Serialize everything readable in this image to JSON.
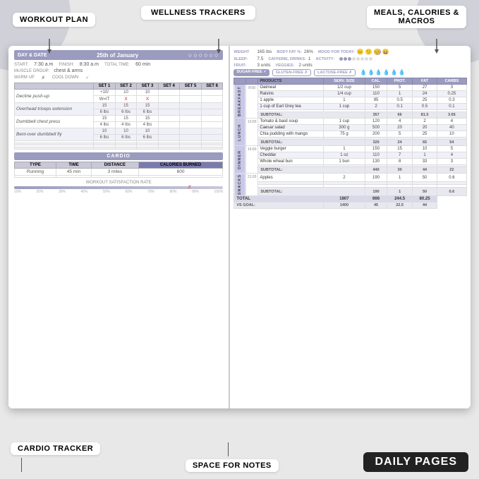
{
  "labels": {
    "workout_plan": "WORKOUT PLAN",
    "wellness_trackers": "WELLNESS TRACKERS",
    "meals_calories": "MEALS, CALORIES &",
    "meals_macros": "MACROS",
    "cardio_tracker": "CARDIO TRACKER",
    "space_for_notes": "SPACE FOR NOTES",
    "daily_pages": "DAILY PAGES"
  },
  "left_page": {
    "day_date_label": "DAY & DATE",
    "date_value": "25th of January",
    "start_label": "START:",
    "start_value": "7:30 a.m",
    "finish_label": "FINISH:",
    "finish_value": "8:30 a.m",
    "total_label": "TOTAL TIME:",
    "total_value": "60 min",
    "muscle_label": "MUSCLE GROUP:",
    "muscle_value": "chest & arms",
    "warm_up_label": "WARM UP",
    "cool_down_label": "COOL DOWN",
    "set_headers": [
      "SET 1",
      "SET 2",
      "SET 3",
      "SET 4",
      "SET 5",
      "SET 6"
    ],
    "exercises": [
      {
        "name": "Decline push-up",
        "sets": [
          "+10/",
          "10",
          "10",
          "",
          "",
          ""
        ]
      },
      {
        "name": "Overhead triceps extension",
        "sets": [
          "W=IT",
          "X",
          "X",
          "",
          "",
          ""
        ]
      },
      {
        "name": "Overhead triceps extension",
        "sets": [
          "15",
          "15",
          "15",
          "",
          "",
          ""
        ]
      },
      {
        "name": "Dumbbell chest press",
        "sets": [
          "6 lbs",
          "6 lbs",
          "6 lbs",
          "",
          "",
          ""
        ]
      },
      {
        "name": "Dumbbell chest press",
        "sets": [
          "15",
          "15",
          "15",
          "",
          "",
          ""
        ]
      },
      {
        "name": "Bent-over dumbbell fly",
        "sets": [
          "4 lbs",
          "4 lbs",
          "4 lbs",
          "",
          "",
          ""
        ]
      },
      {
        "name": "Bent-over dumbbell fly",
        "sets": [
          "10",
          "10",
          "10",
          "",
          "",
          ""
        ]
      },
      {
        "name": "",
        "sets": [
          "6 lbs",
          "6 lbs",
          "6 lbs",
          "",
          "",
          ""
        ]
      }
    ],
    "cardio_label": "CARDIO",
    "cardio_headers": [
      "TYPE",
      "TIME",
      "DISTANCE",
      "CALORIES BURNED"
    ],
    "cardio_rows": [
      [
        "Running",
        "45 min",
        "3 miles",
        "600"
      ]
    ],
    "satisfaction_label": "WORKOUT SATISFACTION RATE",
    "satisfaction_marks": [
      "10%",
      "20%",
      "30%",
      "40%",
      "50%",
      "60%",
      "70%",
      "80%",
      "90%",
      "100%"
    ]
  },
  "right_page": {
    "wellness": {
      "weight_label": "WEIGHT",
      "weight_value": "165 lbs",
      "body_fat_label": "BODY FAT %:",
      "body_fat_value": "26%",
      "mood_label": "MOOD FOR TODAY:",
      "sleep_label": "SLEEP:",
      "sleep_value": "7.5",
      "caffeine_label": "CAFFEINE, DRINKS:",
      "caffeine_value": "1",
      "fruit_label": "Fruit:",
      "fruit_value": "3 units",
      "veggies_label": "VEGGIES:",
      "veggies_value": "2 units",
      "activity_label": "ACTIVITY:"
    },
    "diet_badges": [
      "SUGAR-FREE",
      "GLUTEN-FREE",
      "LACTOSE-FREE"
    ],
    "table_headers": [
      "PRODUCTS",
      "SERV. SIZE",
      "CAL.",
      "PROT.",
      "FAT",
      "CARBS"
    ],
    "meal_sections": [
      {
        "label": "BREAKFAST",
        "time": "8:00",
        "rows": [
          [
            "Oatmeal",
            "1/2 cup",
            "150",
            "5",
            "27",
            "3"
          ],
          [
            "Raisins",
            "1/4 cup",
            "110",
            "1",
            "24",
            "0.25"
          ],
          [
            "1 apple",
            "1",
            "95",
            "0.5",
            "25",
            "0.3"
          ],
          [
            "1 cup of Earl Grey tea",
            "1 cup",
            "2",
            "0.1",
            "0.5",
            "0.1"
          ]
        ],
        "subtotal": [
          "",
          "357",
          "66",
          "81.5",
          "3.65"
        ]
      },
      {
        "label": "LUNCH",
        "time": "13:00",
        "rows": [
          [
            "Tomato & basil soup",
            "1 cup",
            "120",
            "4",
            "2",
            "4"
          ],
          [
            "Caesar salad",
            "300 g",
            "500",
            "20",
            "20",
            "40"
          ],
          [
            "Chia pudding with mango",
            "75 g",
            "200",
            "5",
            "25",
            "10"
          ]
        ],
        "subtotal": [
          "",
          "320",
          "24",
          "65",
          "54"
        ]
      },
      {
        "label": "DINNER",
        "time": "19:00",
        "rows": [
          [
            "Veggie burger",
            "1",
            "150",
            "15",
            "10",
            "5"
          ],
          [
            "Cheddar",
            "1 oz",
            "110",
            "7",
            "1",
            "4"
          ],
          [
            "Whole wheat bun",
            "1 bun",
            "130",
            "8",
            "33",
            "3"
          ]
        ],
        "subtotal": [
          "",
          "440",
          "30",
          "44",
          "22"
        ]
      },
      {
        "label": "SNACKS",
        "time": "21:00",
        "rows": [
          [
            "Apples",
            "2",
            "190",
            "1",
            "50",
            "0.6"
          ]
        ],
        "subtotal": [
          "",
          "190",
          "1",
          "50",
          "0.6"
        ]
      }
    ],
    "total_row": [
      "TOTAL:",
      "",
      "1807",
      "666",
      "244.5",
      "80.25"
    ],
    "vs_goal_row": [
      "VS GOAL:",
      "",
      "1400",
      "45",
      "22.5",
      "44"
    ]
  }
}
